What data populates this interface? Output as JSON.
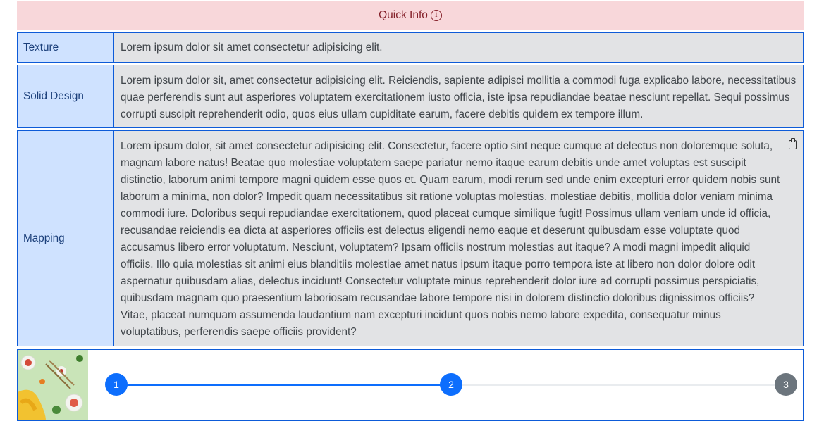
{
  "header": {
    "title": "Quick Info",
    "info_icon": "info-circle-icon"
  },
  "rows": [
    {
      "label": "Texture",
      "value": "Lorem ipsum dolor sit amet consectetur adipisicing elit."
    },
    {
      "label": "Solid Design",
      "value": "Lorem ipsum dolor sit, amet consectetur adipisicing elit. Reiciendis, sapiente adipisci mollitia a commodi fuga explicabo labore, necessitatibus quae perferendis sunt aut asperiores voluptatem exercitationem iusto officia, iste ipsa repudiandae beatae nesciunt repellat. Sequi possimus corrupti suscipit reprehenderit odio, quos eius ullam cupiditate earum, facere debitis quidem ex tempore illum."
    },
    {
      "label": "Mapping",
      "value": "Lorem ipsum dolor, sit amet consectetur adipisicing elit. Consectetur, facere optio sint neque cumque at delectus non doloremque soluta, magnam labore natus! Beatae quo molestiae voluptatem saepe pariatur nemo itaque earum debitis unde amet voluptas est suscipit distinctio, laborum animi tempore magni quidem esse quos et. Quam earum, modi rerum sed unde enim excepturi error quidem nobis sunt laborum a minima, non dolor? Impedit quam necessitatibus sit ratione voluptas molestias, molestiae debitis, mollitia dolor veniam minima commodi iure. Doloribus sequi repudiandae exercitationem, quod placeat cumque similique fugit! Possimus ullam veniam unde id officia, recusandae reiciendis ea dicta at asperiores officiis est delectus eligendi nemo eaque et deserunt quibusdam esse voluptate quod accusamus libero error voluptatum. Nesciunt, voluptatem? Ipsam officiis nostrum molestias aut itaque? A modi magni impedit aliquid officiis. Illo quia molestias sit animi eius blanditiis molestiae amet natus ipsum itaque porro tempora iste at libero non dolor dolore odit aspernatur quibusdam alias, delectus incidunt! Consectetur voluptate minus reprehenderit dolor iure ad corrupti possimus perspiciatis, quibusdam magnam quo praesentium laboriosam recusandae labore tempore nisi in dolorem distinctio doloribus dignissimos officiis? Vitae, placeat numquam assumenda laudantium nam excepturi incidunt quos nobis nemo labore expedita, consequatur minus voluptatibus, perferendis saepe officiis provident?",
      "copy_icon": "clipboard-icon"
    }
  ],
  "stepper": {
    "progress_fraction": 0.5,
    "steps": [
      {
        "label": "1",
        "state": "completed"
      },
      {
        "label": "2",
        "state": "current"
      },
      {
        "label": "3",
        "state": "upcoming"
      }
    ],
    "colors": {
      "active": "#0d6efd",
      "inactive": "#6c757d"
    }
  },
  "colors": {
    "header_bg": "#f8d7da",
    "label_bg": "#cfe2ff",
    "value_bg": "#e2e3e5",
    "border": "#0d5bd8"
  }
}
